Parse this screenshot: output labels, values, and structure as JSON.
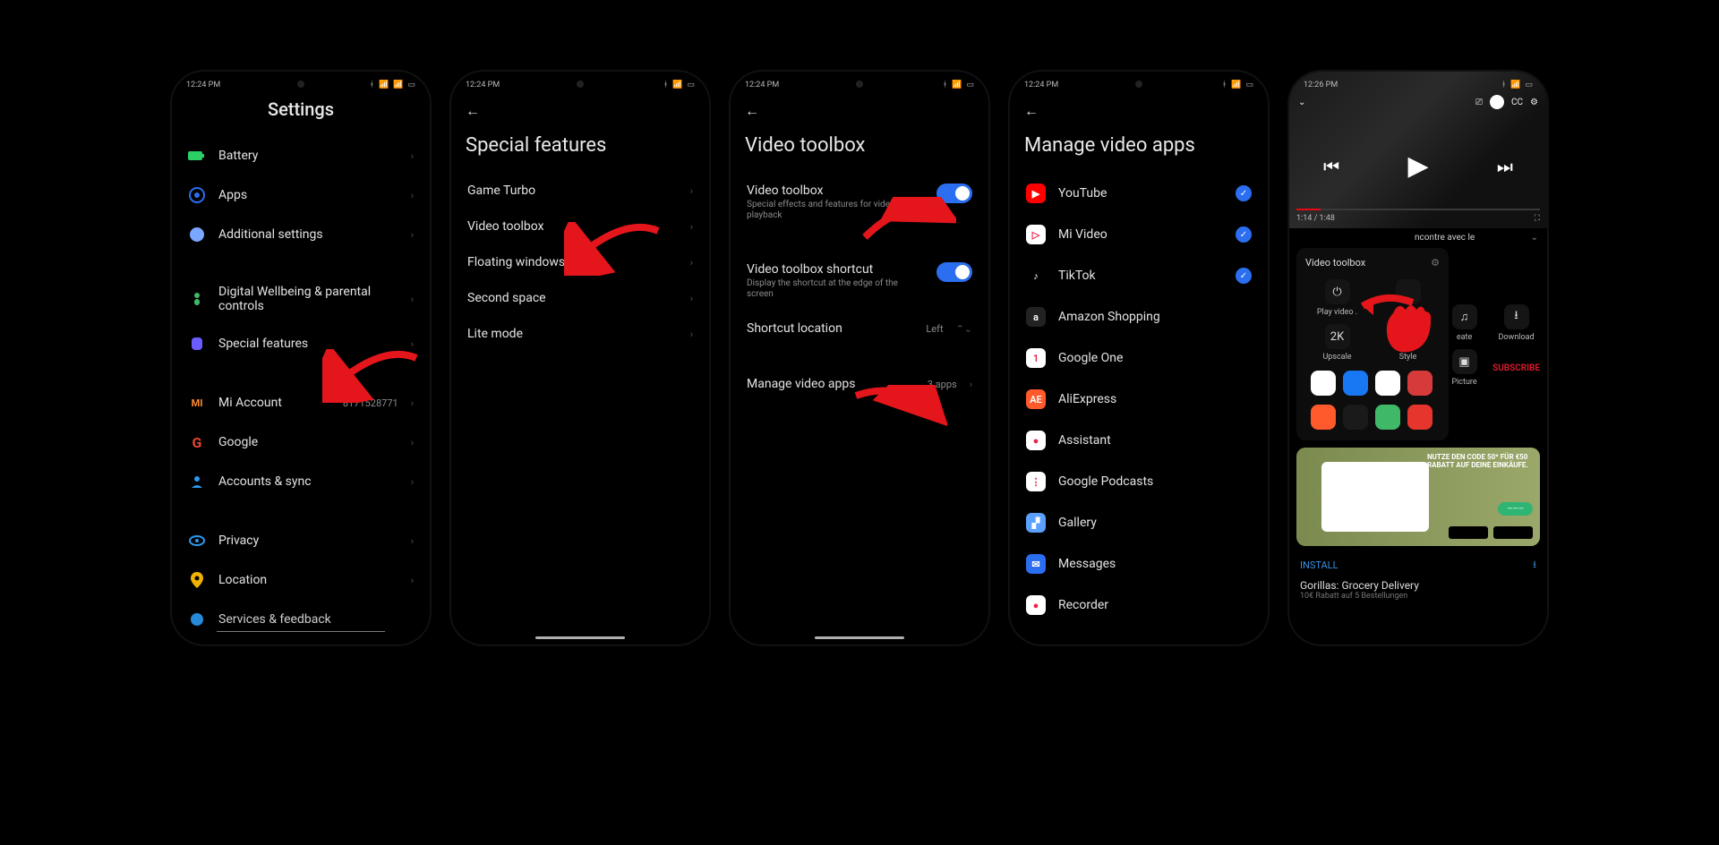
{
  "colors": {
    "accent": "#2b6ef0",
    "red": "#e4161b"
  },
  "status": {
    "time1": "12:24 PM",
    "time5": "12:26 PM",
    "bt": "􀖀"
  },
  "screen1": {
    "title": "Settings",
    "items": [
      {
        "icon": "battery",
        "color": "#2bcf63",
        "label": "Battery"
      },
      {
        "icon": "apps",
        "color": "#2b6ef0",
        "label": "Apps"
      },
      {
        "icon": "dots",
        "color": "#7aa7ff",
        "label": "Additional settings"
      }
    ],
    "items2": [
      {
        "icon": "wellbeing",
        "color": "#3fb968",
        "label": "Digital Wellbeing & parental controls"
      },
      {
        "icon": "special",
        "color": "#6b5cff",
        "label": "Special features"
      }
    ],
    "items3": [
      {
        "icon": "mi",
        "color": "#ff8a2a",
        "label": "Mi Account",
        "value": "8171528771"
      },
      {
        "icon": "google",
        "color": "#fff",
        "label": "Google"
      },
      {
        "icon": "accounts",
        "color": "#2b9af0",
        "label": "Accounts & sync"
      }
    ],
    "items4": [
      {
        "icon": "privacy",
        "color": "#2b9af0",
        "label": "Privacy"
      },
      {
        "icon": "location",
        "color": "#f1b300",
        "label": "Location"
      },
      {
        "icon": "services",
        "color": "#2b9af0",
        "label": "Services & feedback"
      }
    ]
  },
  "screen2": {
    "title": "Special features",
    "items": [
      {
        "label": "Game Turbo"
      },
      {
        "label": "Video toolbox"
      },
      {
        "label": "Floating windows"
      },
      {
        "label": "Second space"
      },
      {
        "label": "Lite mode"
      }
    ]
  },
  "screen3": {
    "title": "Video toolbox",
    "items": [
      {
        "label": "Video toolbox",
        "sub": "Special effects and features for video playback",
        "toggle": true
      },
      {
        "label": "Video toolbox shortcut",
        "sub": "Display the shortcut at the edge of the screen",
        "toggle": true
      },
      {
        "label": "Shortcut location",
        "value": "Left"
      }
    ],
    "manage": {
      "label": "Manage video apps",
      "value": "3 apps"
    }
  },
  "screen4": {
    "title": "Manage video apps",
    "apps": [
      {
        "name": "YouTube",
        "color": "#ff0000",
        "checked": true,
        "glyph": "▶"
      },
      {
        "name": "Mi Video",
        "color": "#fff",
        "checked": true,
        "glyph": "▷"
      },
      {
        "name": "TikTok",
        "color": "#000",
        "checked": true,
        "glyph": "♪"
      },
      {
        "name": "Amazon Shopping",
        "color": "#222",
        "checked": false,
        "glyph": "a"
      },
      {
        "name": "Google One",
        "color": "#fff",
        "checked": false,
        "glyph": "1"
      },
      {
        "name": "AliExpress",
        "color": "#ff5a2b",
        "checked": false,
        "glyph": "AE"
      },
      {
        "name": "Assistant",
        "color": "#fff",
        "checked": false,
        "glyph": "●"
      },
      {
        "name": "Google Podcasts",
        "color": "#fff",
        "checked": false,
        "glyph": "⋮"
      },
      {
        "name": "Gallery",
        "color": "#5aa0ff",
        "checked": false,
        "glyph": "▞"
      },
      {
        "name": "Messages",
        "color": "#2b6ef0",
        "checked": false,
        "glyph": "✉"
      },
      {
        "name": "Recorder",
        "color": "#fff",
        "checked": false,
        "glyph": "●"
      }
    ]
  },
  "screen5": {
    "videoTime": "1:14 / 1:48",
    "videoTitle": "ncontre avec le",
    "panelTitle": "Video toolbox",
    "tools": [
      {
        "label": "Play video ."
      },
      {
        "label": ""
      },
      {
        "label": "eate"
      },
      {
        "label": "Download"
      },
      {
        "label": "Upscale"
      },
      {
        "label": "Style"
      },
      {
        "label": "Picture"
      },
      {
        "label": ""
      }
    ],
    "subscribe": "SUBSCRIBE",
    "adText": "NUTZE DEN CODE 50* FÜR €50 RABATT AUF DEINE EINKÄUFE.",
    "install": "INSTALL",
    "appTitle": "Gorillas: Grocery Delivery",
    "appSub": "10€ Rabatt auf 5 Bestellungen"
  }
}
